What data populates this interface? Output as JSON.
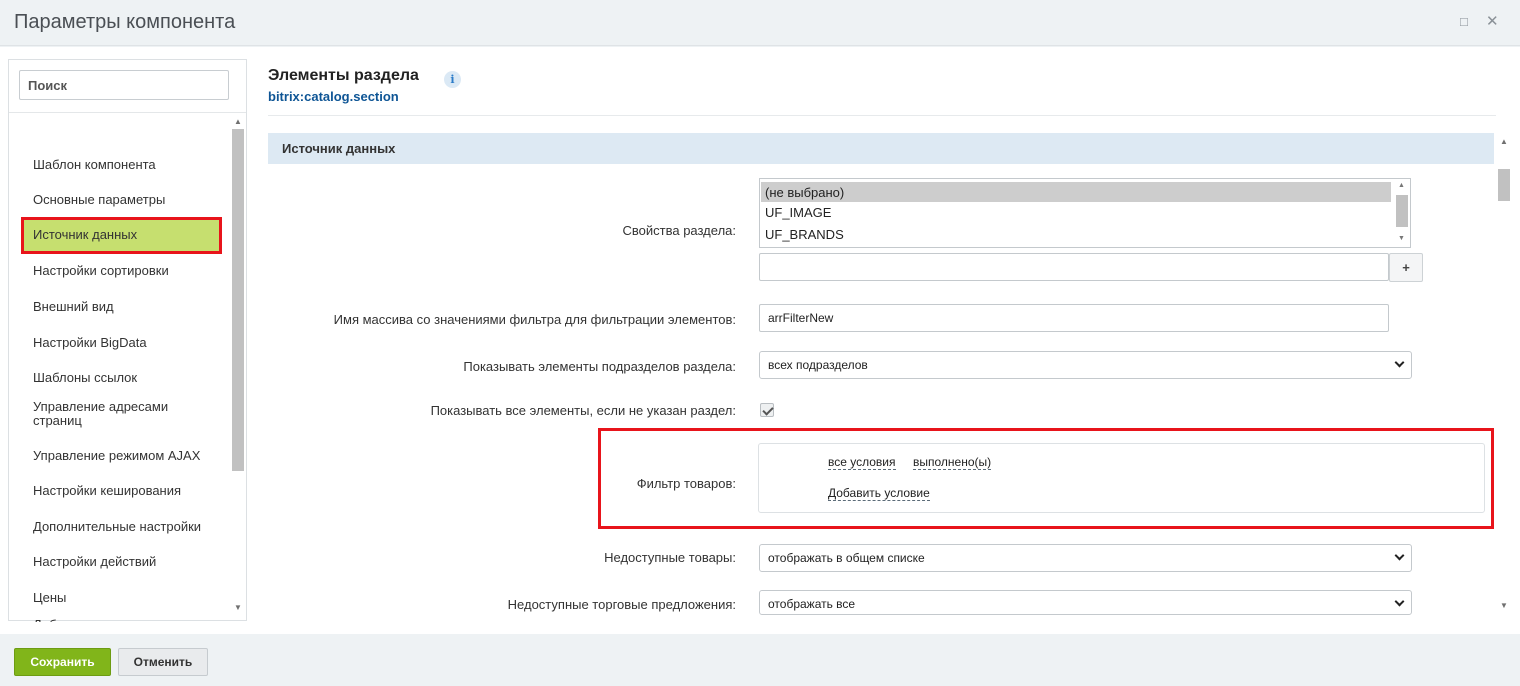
{
  "window": {
    "title": "Параметры компонента",
    "maximize_icon": "□",
    "close_icon": "✕"
  },
  "sidebar": {
    "search_placeholder": "Поиск",
    "items": [
      {
        "label": "Шаблон компонента"
      },
      {
        "label": "Основные параметры"
      },
      {
        "label": "Источник данных",
        "active": true
      },
      {
        "label": "Настройки сортировки"
      },
      {
        "label": "Внешний вид"
      },
      {
        "label": "Настройки BigData"
      },
      {
        "label": "Шаблоны ссылок"
      },
      {
        "label": "Управление адресами страниц"
      },
      {
        "label": "Управление режимом AJAX"
      },
      {
        "label": "Настройки кеширования"
      },
      {
        "label": "Дополнительные настройки"
      },
      {
        "label": "Настройки действий"
      },
      {
        "label": "Цены"
      },
      {
        "label": "Добавление в корзину"
      }
    ]
  },
  "main": {
    "title": "Элементы раздела",
    "info_icon": "i",
    "component_code": "bitrix:catalog.section",
    "section_title": "Источник данных",
    "section_props": {
      "label": "Свойства раздела:",
      "options": [
        "(не выбрано)",
        "UF_IMAGE",
        "UF_BRANDS"
      ],
      "selected": "(не выбрано)",
      "extra_value": "",
      "add_button": "+"
    },
    "filter_name": {
      "label": "Имя массива со значениями фильтра для фильтрации элементов:",
      "value": "arrFilterNew"
    },
    "include_subsections": {
      "label": "Показывать элементы подразделов раздела:",
      "value": "всех подразделов"
    },
    "show_all_wo_section": {
      "label": "Показывать все элементы, если не указан раздел:",
      "checked": true
    },
    "product_filter": {
      "label": "Фильтр товаров:",
      "condition_all": "все условия",
      "condition_done": "выполнено(ы)",
      "add_condition": "Добавить условие"
    },
    "unavailable_products": {
      "label": "Недоступные товары:",
      "value": "отображать в общем списке"
    },
    "unavailable_offers": {
      "label": "Недоступные торговые предложения:",
      "value": "отображать все"
    }
  },
  "footer": {
    "save_label": "Сохранить",
    "cancel_label": "Отменить"
  },
  "colors": {
    "active_menu_bg": "#c6df6f",
    "highlight_border": "#e8141b",
    "save_button": "#81b51a",
    "section_bg": "#dde9f3",
    "code_link": "#0e5595"
  }
}
